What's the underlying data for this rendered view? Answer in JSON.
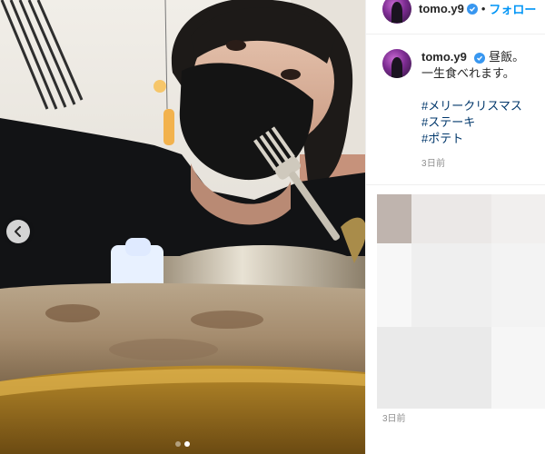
{
  "post": {
    "username": "tomo.y9",
    "follow_label": "フォロー",
    "caption": {
      "text_line1": "昼飯。",
      "text_line2": "一生食べれます。",
      "hashtags": [
        "#メリークリスマス",
        "#ステーキ",
        "#ポテト"
      ]
    },
    "timestamp": "3日前",
    "carousel": {
      "total": 2,
      "current": 2
    }
  },
  "comments": {
    "timestamp": "3日前"
  },
  "colors": {
    "link_blue": "#0095f6",
    "hashtag": "#00376b",
    "verified": "#3897f0",
    "muted": "#8e8e8e"
  },
  "icons": [
    "chevron-left-icon",
    "verified-badge-icon"
  ]
}
